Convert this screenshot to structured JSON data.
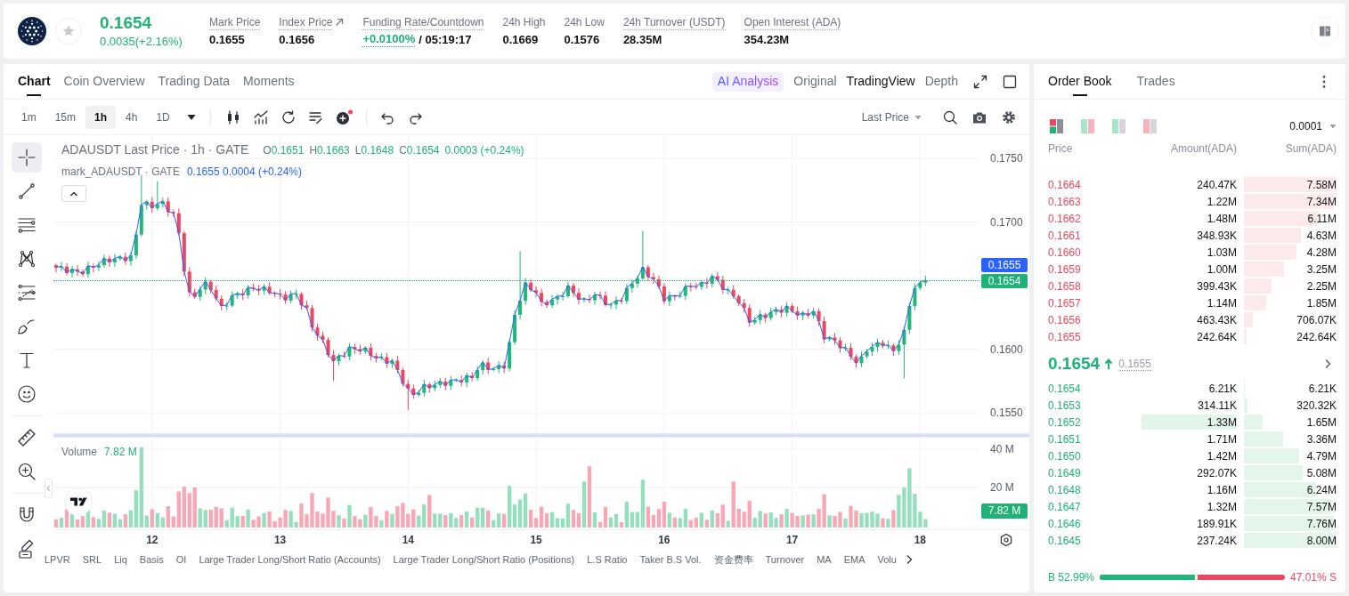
{
  "header": {
    "favorite": false,
    "price": "0.1654",
    "change": "0.0035(+2.16%)",
    "stats": [
      {
        "kind": "plain",
        "label": "Mark Price",
        "value": "0.1655",
        "underlined": true
      },
      {
        "kind": "link",
        "label": "Index Price",
        "value": "0.1656",
        "underlined": true
      },
      {
        "kind": "funding",
        "label": "Funding Rate/Countdown",
        "value": "+0.0100%",
        "countdown": "/ 05:19:17",
        "underlined": true
      },
      {
        "kind": "plain",
        "label": "24h High",
        "value": "0.1669",
        "underlined": false
      },
      {
        "kind": "plain",
        "label": "24h Low",
        "value": "0.1576",
        "underlined": false
      },
      {
        "kind": "plain",
        "label": "24h Turnover (USDT)",
        "value": "28.35M",
        "underlined": true
      },
      {
        "kind": "plain",
        "label": "Open Interest (ADA)",
        "value": "354.23M",
        "underlined": true
      }
    ]
  },
  "chart_panel": {
    "tabs": [
      {
        "label": "Chart",
        "selected": true
      },
      {
        "label": "Coin Overview",
        "selected": false
      },
      {
        "label": "Trading Data",
        "selected": false
      },
      {
        "label": "Moments",
        "selected": false
      }
    ],
    "views": [
      {
        "kind": "ai",
        "label": "AI Analysis",
        "selected": false
      },
      {
        "kind": "mode",
        "label": "Original",
        "selected": false
      },
      {
        "kind": "mode",
        "label": "TradingView",
        "selected": true
      },
      {
        "kind": "mode",
        "label": "Depth",
        "selected": false
      }
    ],
    "intervals": [
      {
        "label": "1m",
        "selected": false
      },
      {
        "label": "15m",
        "selected": false
      },
      {
        "label": "1h",
        "selected": true
      },
      {
        "label": "4h",
        "selected": false
      },
      {
        "label": "1D",
        "selected": false
      }
    ],
    "price_source": "Last Price",
    "tool_groups": [
      [
        {
          "kind": "crosshair",
          "selected": true
        },
        {
          "kind": "trend_line",
          "selected": false
        },
        {
          "kind": "parallel_lines",
          "selected": false
        },
        {
          "kind": "pattern",
          "selected": false
        },
        {
          "kind": "fib",
          "selected": false
        },
        {
          "kind": "brush",
          "selected": false
        },
        {
          "kind": "text",
          "selected": false
        },
        {
          "kind": "emoji",
          "selected": false
        }
      ],
      [
        {
          "kind": "ruler",
          "selected": false
        },
        {
          "kind": "zoom",
          "selected": false
        }
      ],
      [
        {
          "kind": "magnet",
          "selected": false
        },
        {
          "kind": "pencil",
          "selected": false
        }
      ]
    ],
    "legend": {
      "title": "ADAUSDT Last Price · 1h · GATE",
      "ohlc": [
        {
          "key": "O",
          "value": "0.1651"
        },
        {
          "key": "H",
          "value": "0.1663"
        },
        {
          "key": "L",
          "value": "0.1648"
        },
        {
          "key": "C",
          "value": "0.1654"
        }
      ],
      "change": "0.0003 (+0.24%)",
      "mark_title": "mark_ADAUSDT · GATE",
      "mark_values": "0.1655 0.0004 (+0.24%)"
    },
    "price_axis": [
      "0.1750",
      "0.1700",
      "0.1600",
      "0.1550"
    ],
    "mark_price_tag": "0.1655",
    "last_price_tag": "0.1654",
    "volume": {
      "label": "Volume",
      "value": "7.82 M",
      "axis": [
        "40 M",
        "20 M"
      ],
      "tag": "7.82 M"
    },
    "time_axis": [
      "12",
      "13",
      "14",
      "15",
      "16",
      "17",
      "18"
    ],
    "indicators": [
      "LPVR",
      "SRL",
      "Liq",
      "Basis",
      "OI",
      "Large Trader Long/Short Ratio (Accounts)",
      "Large Trader Long/Short Ratio (Positions)",
      "L.S Ratio",
      "Taker B.S Vol.",
      "资金费率",
      "Turnover",
      "MA",
      "EMA",
      "Volu"
    ]
  },
  "order_book": {
    "tabs": [
      {
        "label": "Order Book",
        "selected": true
      },
      {
        "label": "Trades",
        "selected": false
      }
    ],
    "layouts": [
      {
        "kind": "split",
        "selected": true
      },
      {
        "kind": "both",
        "selected": false
      },
      {
        "kind": "bids",
        "selected": false
      },
      {
        "kind": "asks",
        "selected": false
      }
    ],
    "precision": "0.0001",
    "columns": [
      "Price",
      "Amount(ADA)",
      "Sum(ADA)"
    ],
    "asks": [
      {
        "price": "0.1664",
        "amount": "240.47K",
        "sum": "7.58M",
        "level": 1,
        "highlighted": false
      },
      {
        "price": "0.1663",
        "amount": "1.22M",
        "sum": "7.34M",
        "level": 0.968,
        "highlighted": false
      },
      {
        "price": "0.1662",
        "amount": "1.48M",
        "sum": "6.11M",
        "level": 0.806,
        "highlighted": false
      },
      {
        "price": "0.1661",
        "amount": "348.93K",
        "sum": "4.63M",
        "level": 0.611,
        "highlighted": false
      },
      {
        "price": "0.1660",
        "amount": "1.03M",
        "sum": "4.28M",
        "level": 0.565,
        "highlighted": false
      },
      {
        "price": "0.1659",
        "amount": "1.00M",
        "sum": "3.25M",
        "level": 0.429,
        "highlighted": false
      },
      {
        "price": "0.1658",
        "amount": "399.43K",
        "sum": "2.25M",
        "level": 0.297,
        "highlighted": false
      },
      {
        "price": "0.1657",
        "amount": "1.14M",
        "sum": "1.85M",
        "level": 0.244,
        "highlighted": false
      },
      {
        "price": "0.1656",
        "amount": "463.43K",
        "sum": "706.07K",
        "level": 0.093,
        "highlighted": false
      },
      {
        "price": "0.1655",
        "amount": "242.64K",
        "sum": "242.64K",
        "level": 0.032,
        "highlighted": false
      }
    ],
    "mid": {
      "price": "0.1654",
      "rising": true,
      "mark": "0.1655"
    },
    "bids": [
      {
        "price": "0.1654",
        "amount": "6.21K",
        "sum": "6.21K",
        "level": 0.001,
        "highlighted": false
      },
      {
        "price": "0.1653",
        "amount": "314.11K",
        "sum": "320.32K",
        "level": 0.04,
        "highlighted": false
      },
      {
        "price": "0.1652",
        "amount": "1.33M",
        "sum": "1.65M",
        "level": 0.206,
        "highlighted": true
      },
      {
        "price": "0.1651",
        "amount": "1.71M",
        "sum": "3.36M",
        "level": 0.42,
        "highlighted": false
      },
      {
        "price": "0.1650",
        "amount": "1.42M",
        "sum": "4.79M",
        "level": 0.599,
        "highlighted": false
      },
      {
        "price": "0.1649",
        "amount": "292.07K",
        "sum": "5.08M",
        "level": 0.635,
        "highlighted": false
      },
      {
        "price": "0.1648",
        "amount": "1.16M",
        "sum": "6.24M",
        "level": 0.78,
        "highlighted": false
      },
      {
        "price": "0.1647",
        "amount": "1.32M",
        "sum": "7.57M",
        "level": 0.946,
        "highlighted": false
      },
      {
        "price": "0.1646",
        "amount": "189.91K",
        "sum": "7.76M",
        "level": 0.97,
        "highlighted": false
      },
      {
        "price": "0.1645",
        "amount": "237.24K",
        "sum": "8.00M",
        "level": 1,
        "highlighted": false
      }
    ],
    "ratio": {
      "buy": "B 52.99%",
      "sell": "47.01% S",
      "level": 0.5299
    }
  }
}
